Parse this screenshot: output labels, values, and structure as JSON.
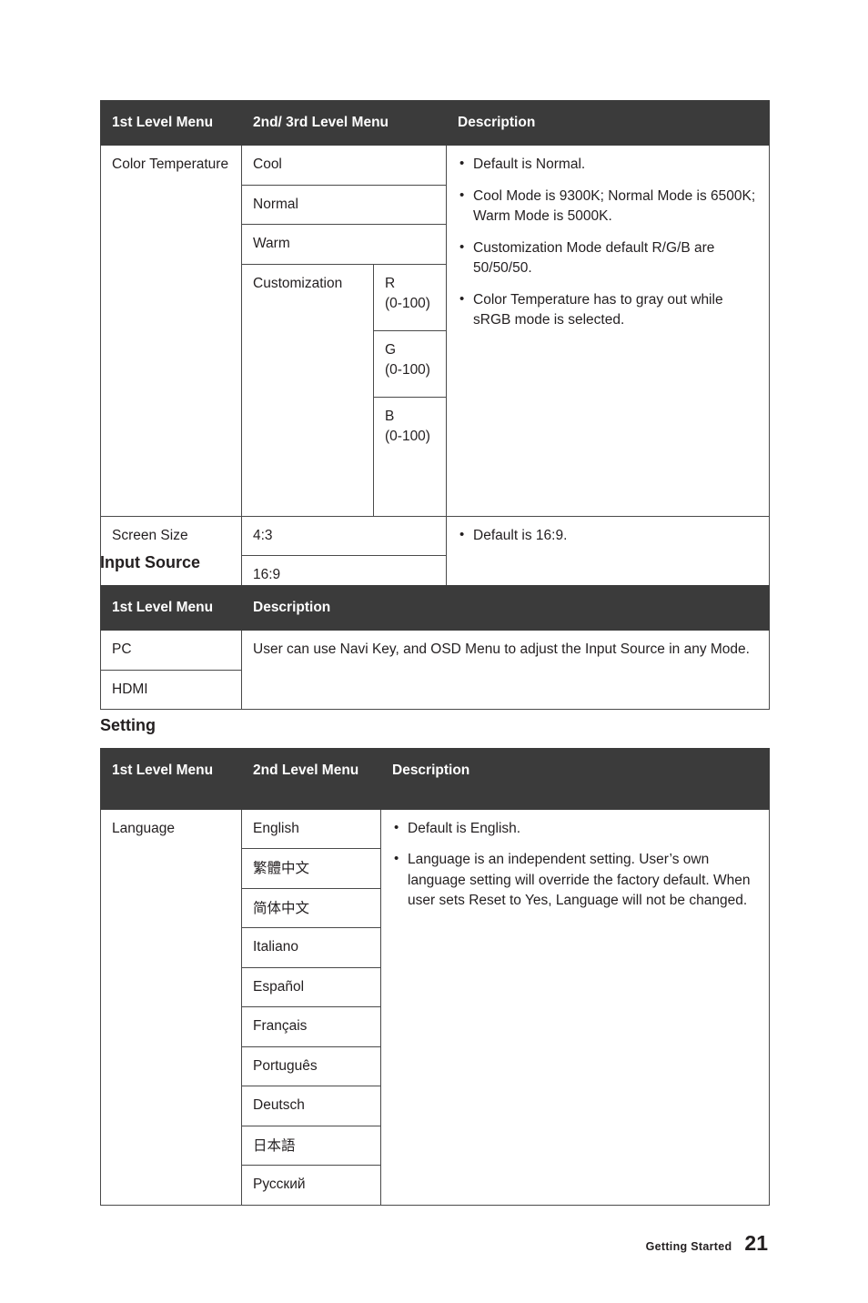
{
  "tables": {
    "color": {
      "headers": [
        "1st Level Menu",
        "2nd/ 3rd Level Menu",
        "Description"
      ],
      "rows": [
        {
          "level1": "Color Temperature",
          "level2": [
            "Cool",
            "Normal",
            "Warm",
            "Customization"
          ],
          "level3": [
            "R\n(0-100)",
            "G\n(0-100)",
            "B\n(0-100)"
          ],
          "level3_items": [
            {
              "label": "R",
              "range": "(0-100)"
            },
            {
              "label": "G",
              "range": "(0-100)"
            },
            {
              "label": "B",
              "range": "(0-100)"
            }
          ],
          "description": [
            "Default is Normal.",
            "Cool Mode is 9300K; Normal Mode is 6500K; Warm Mode is 5000K.",
            "Customization Mode default R/G/B are 50/50/50.",
            "Color Temperature has to gray out while sRGB mode is selected."
          ]
        },
        {
          "level1": "Screen Size",
          "level2": [
            "4:3",
            "16:9"
          ],
          "description": [
            "Default is 16:9."
          ]
        }
      ]
    },
    "input_source": {
      "title": "Input Source",
      "headers": [
        "1st Level Menu",
        "Description"
      ],
      "items": [
        "PC",
        "HDMI"
      ],
      "description": "User can use Navi Key, and OSD Menu to adjust the Input Source in any Mode."
    },
    "setting": {
      "title": "Setting",
      "headers": [
        "1st Level Menu",
        "2nd Level Menu",
        "Description"
      ],
      "level1": "Language",
      "languages": [
        "English",
        "繁體中文",
        "简体中文",
        "Italiano",
        "Español",
        "Français",
        "Português",
        "Deutsch",
        "日本語",
        "Русский"
      ],
      "description": [
        "Default is English.",
        "Language is an independent setting. User’s own language setting will override the factory default. When user sets Reset to Yes, Language will not be changed."
      ]
    }
  },
  "footer": {
    "label": "Getting Started",
    "page_number": "21"
  }
}
